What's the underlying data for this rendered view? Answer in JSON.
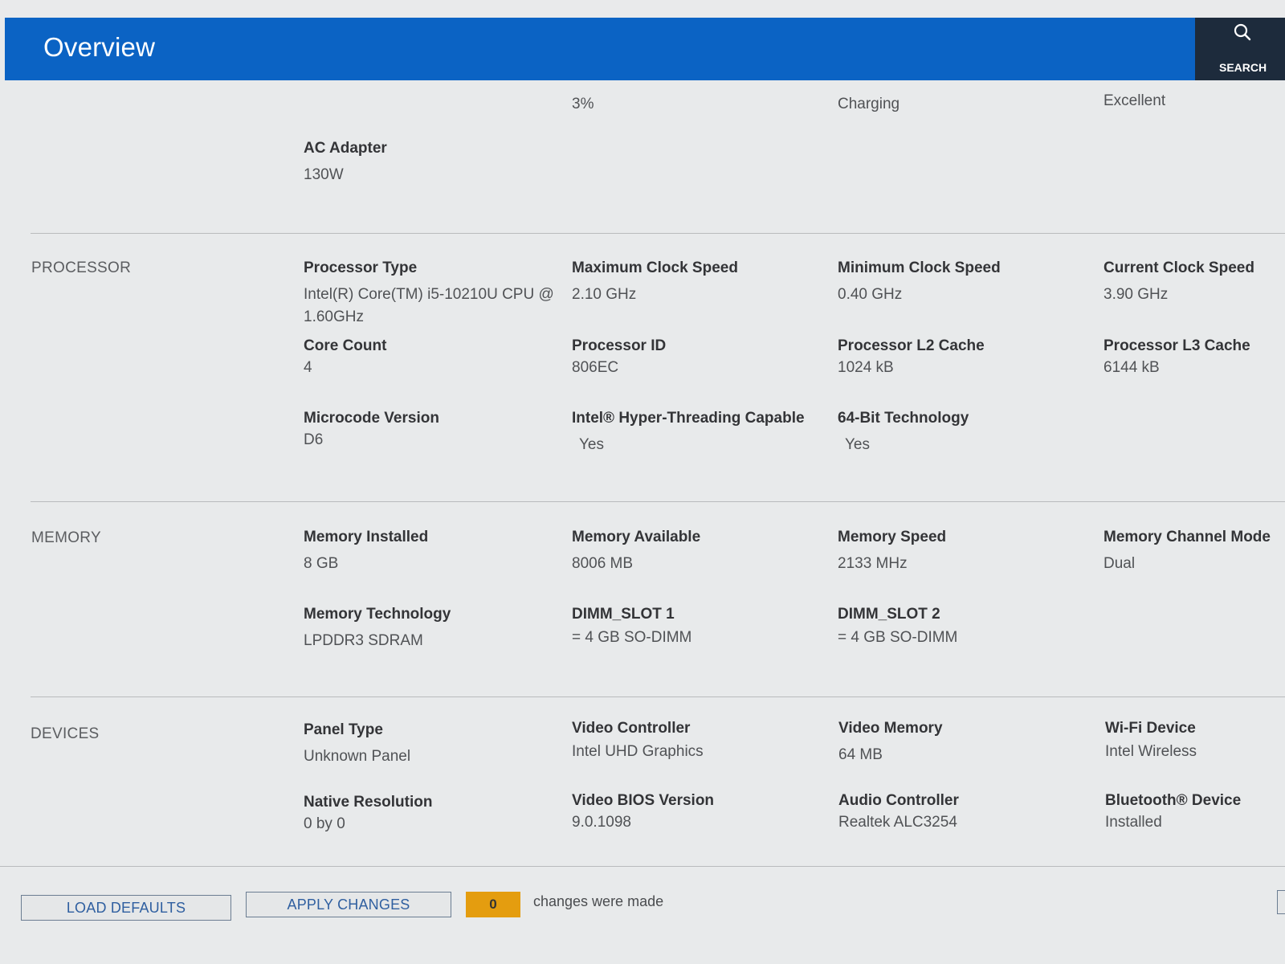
{
  "header": {
    "title": "Overview",
    "search_label": "SEARCH"
  },
  "battery": {
    "values": [
      "3%",
      "Charging",
      "Excellent"
    ],
    "ac_adapter": {
      "label": "AC Adapter",
      "value": "130W"
    }
  },
  "processor": {
    "section": "PROCESSOR",
    "fields": [
      {
        "label": "Processor Type",
        "value": "Intel(R) Core(TM) i5-10210U CPU @",
        "value2": "1.60GHz"
      },
      {
        "label": "Maximum Clock Speed",
        "value": "2.10 GHz"
      },
      {
        "label": "Minimum Clock Speed",
        "value": "0.40 GHz"
      },
      {
        "label": "Current Clock Speed",
        "value": "3.90 GHz"
      },
      {
        "label": "Core Count",
        "value": "4"
      },
      {
        "label": "Processor ID",
        "value": "806EC"
      },
      {
        "label": "Processor L2 Cache",
        "value": "1024 kB"
      },
      {
        "label": "Processor L3 Cache",
        "value": "6144 kB"
      },
      {
        "label": "Microcode Version",
        "value": "D6"
      },
      {
        "label": "Intel® Hyper-Threading Capable",
        "value": "Yes"
      },
      {
        "label": "64-Bit Technology",
        "value": "Yes"
      }
    ]
  },
  "memory": {
    "section": "MEMORY",
    "fields": [
      {
        "label": "Memory Installed",
        "value": "8 GB"
      },
      {
        "label": "Memory Available",
        "value": "8006 MB"
      },
      {
        "label": "Memory Speed",
        "value": "2133 MHz"
      },
      {
        "label": "Memory Channel Mode",
        "value": "Dual"
      },
      {
        "label": "Memory Technology",
        "value": "LPDDR3 SDRAM"
      },
      {
        "label": "DIMM_SLOT 1",
        "value": "= 4 GB SO-DIMM"
      },
      {
        "label": "DIMM_SLOT 2",
        "value": "= 4 GB SO-DIMM"
      }
    ]
  },
  "devices": {
    "section": "DEVICES",
    "fields": [
      {
        "label": "Panel Type",
        "value": "Unknown Panel"
      },
      {
        "label": "Video Controller",
        "value": "Intel UHD Graphics"
      },
      {
        "label": "Video Memory",
        "value": "64 MB"
      },
      {
        "label": "Wi-Fi Device",
        "value": "Intel Wireless"
      },
      {
        "label": "Native Resolution",
        "value": "0 by 0"
      },
      {
        "label": "Video BIOS Version",
        "value": "9.0.1098"
      },
      {
        "label": "Audio Controller",
        "value": "Realtek ALC3254"
      },
      {
        "label": "Bluetooth® Device",
        "value": "Installed"
      }
    ]
  },
  "footer": {
    "load_defaults": "LOAD DEFAULTS",
    "apply_changes": "APPLY CHANGES",
    "changes_count": "0",
    "changes_text": "changes were made"
  },
  "colors": {
    "header": "#0b63c4",
    "search_bg": "#1d2b3c",
    "counter": "#e49d0f"
  }
}
